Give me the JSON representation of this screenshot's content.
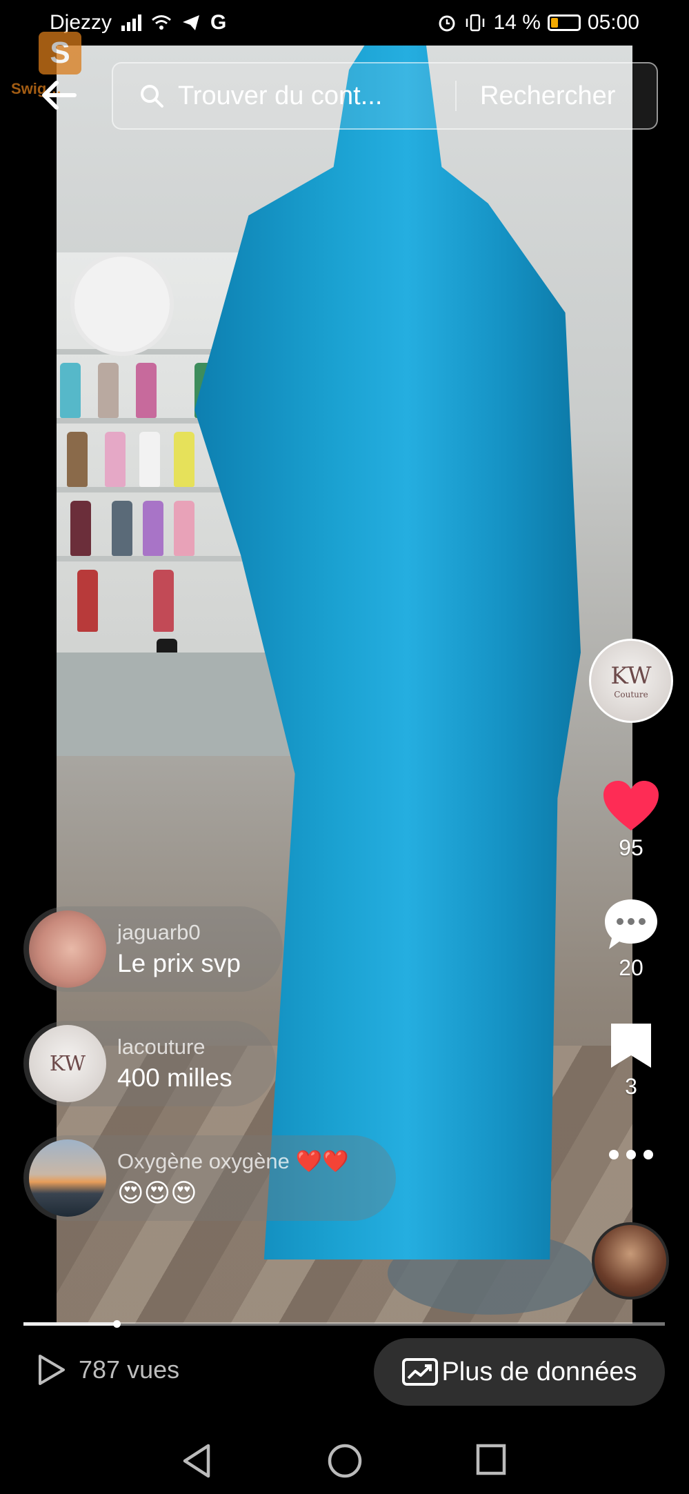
{
  "status_bar": {
    "carrier": "Djezzy",
    "battery": "14 %",
    "time": "05:00",
    "icons": [
      "signal-icon",
      "wifi-icon",
      "telegram-icon",
      "google-icon",
      "alarm-icon",
      "vibrate-icon",
      "battery-icon"
    ]
  },
  "watermark": {
    "text": "Swig…"
  },
  "search": {
    "placeholder": "Trouver du cont...",
    "button": "Rechercher"
  },
  "right_rail": {
    "likes": "95",
    "comments": "20",
    "saves": "3",
    "creator_badge": "KW",
    "creator_sub": "Couture"
  },
  "comments": [
    {
      "user": "jaguarb0",
      "text": "Le prix svp"
    },
    {
      "user": "lacouture",
      "text": "400 milles"
    },
    {
      "user": "Oxygène oxygène",
      "text": "😍😍😍",
      "hearts": "❤️❤️"
    }
  ],
  "progress": {
    "fraction": 0.145
  },
  "footer": {
    "views": "787 vues",
    "more_button": "Plus de données"
  },
  "colors": {
    "like_red": "#fe2c55",
    "dress_blue": "#1aa0d0",
    "button_bg": "#2f2f2f"
  }
}
